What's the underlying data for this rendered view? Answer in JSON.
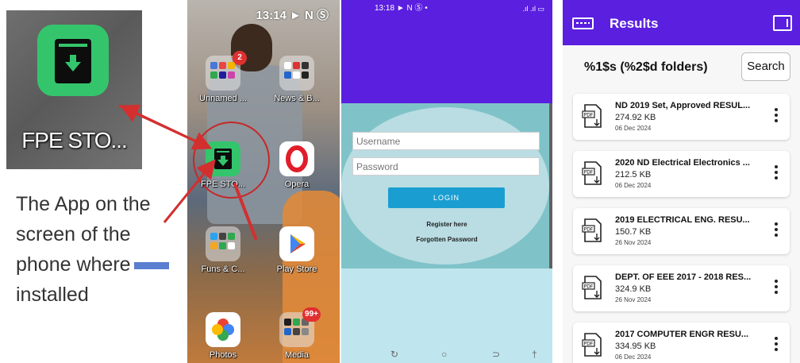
{
  "panel1": {
    "zoom_label": "FPE STO...",
    "caption_lines": [
      "The App on the",
      "screen of the",
      "phone where",
      "installed"
    ]
  },
  "panel2": {
    "status_time": "13:14",
    "status_icons": "► N Ⓢ",
    "apps": [
      {
        "label": "Unnamed ...",
        "badge": "2"
      },
      {
        "label": "News & B..."
      },
      {
        "label": "FPE STO..."
      },
      {
        "label": "Opera"
      },
      {
        "label": "Funs & C..."
      },
      {
        "label": "Play Store"
      },
      {
        "label": "Photos"
      },
      {
        "label": "Media",
        "badge": "99+"
      }
    ]
  },
  "panel3": {
    "status_time": "13:18",
    "status_icons": "► N Ⓢ •",
    "status_right": ".ıl .ıl ▭",
    "username_placeholder": "Username",
    "password_placeholder": "Password",
    "login_label": "LOGIN",
    "register_label": "Register here",
    "forgot_label": "Forgotten Password",
    "nav": [
      "↻",
      "○",
      "⊃",
      "†"
    ]
  },
  "panel4": {
    "title": "Results",
    "heading": "%1$s (%2$d folders)",
    "search_label": "Search",
    "files": [
      {
        "name": "ND 2019 Set, Approved RESUL...",
        "size": "274.92 KB",
        "date": "06 Dec 2024"
      },
      {
        "name": "2020 ND Electrical Electronics ...",
        "size": "212.5 KB",
        "date": "06 Dec 2024"
      },
      {
        "name": "2019 ELECTRICAL ENG. RESU...",
        "size": "150.7 KB",
        "date": "26 Nov 2024"
      },
      {
        "name": "DEPT. OF EEE 2017 - 2018 RES...",
        "size": "324.9 KB",
        "date": "26 Nov 2024"
      },
      {
        "name": "2017 COMPUTER ENGR  RESU...",
        "size": "334.95 KB",
        "date": "06 Dec 2024"
      }
    ],
    "pdf_icon_text": "PDF"
  },
  "colors": {
    "brand_purple": "#5b1fe0",
    "app_green": "#34c56c",
    "login_blue": "#1a9ed1",
    "annotation_red": "#d32f2f"
  }
}
